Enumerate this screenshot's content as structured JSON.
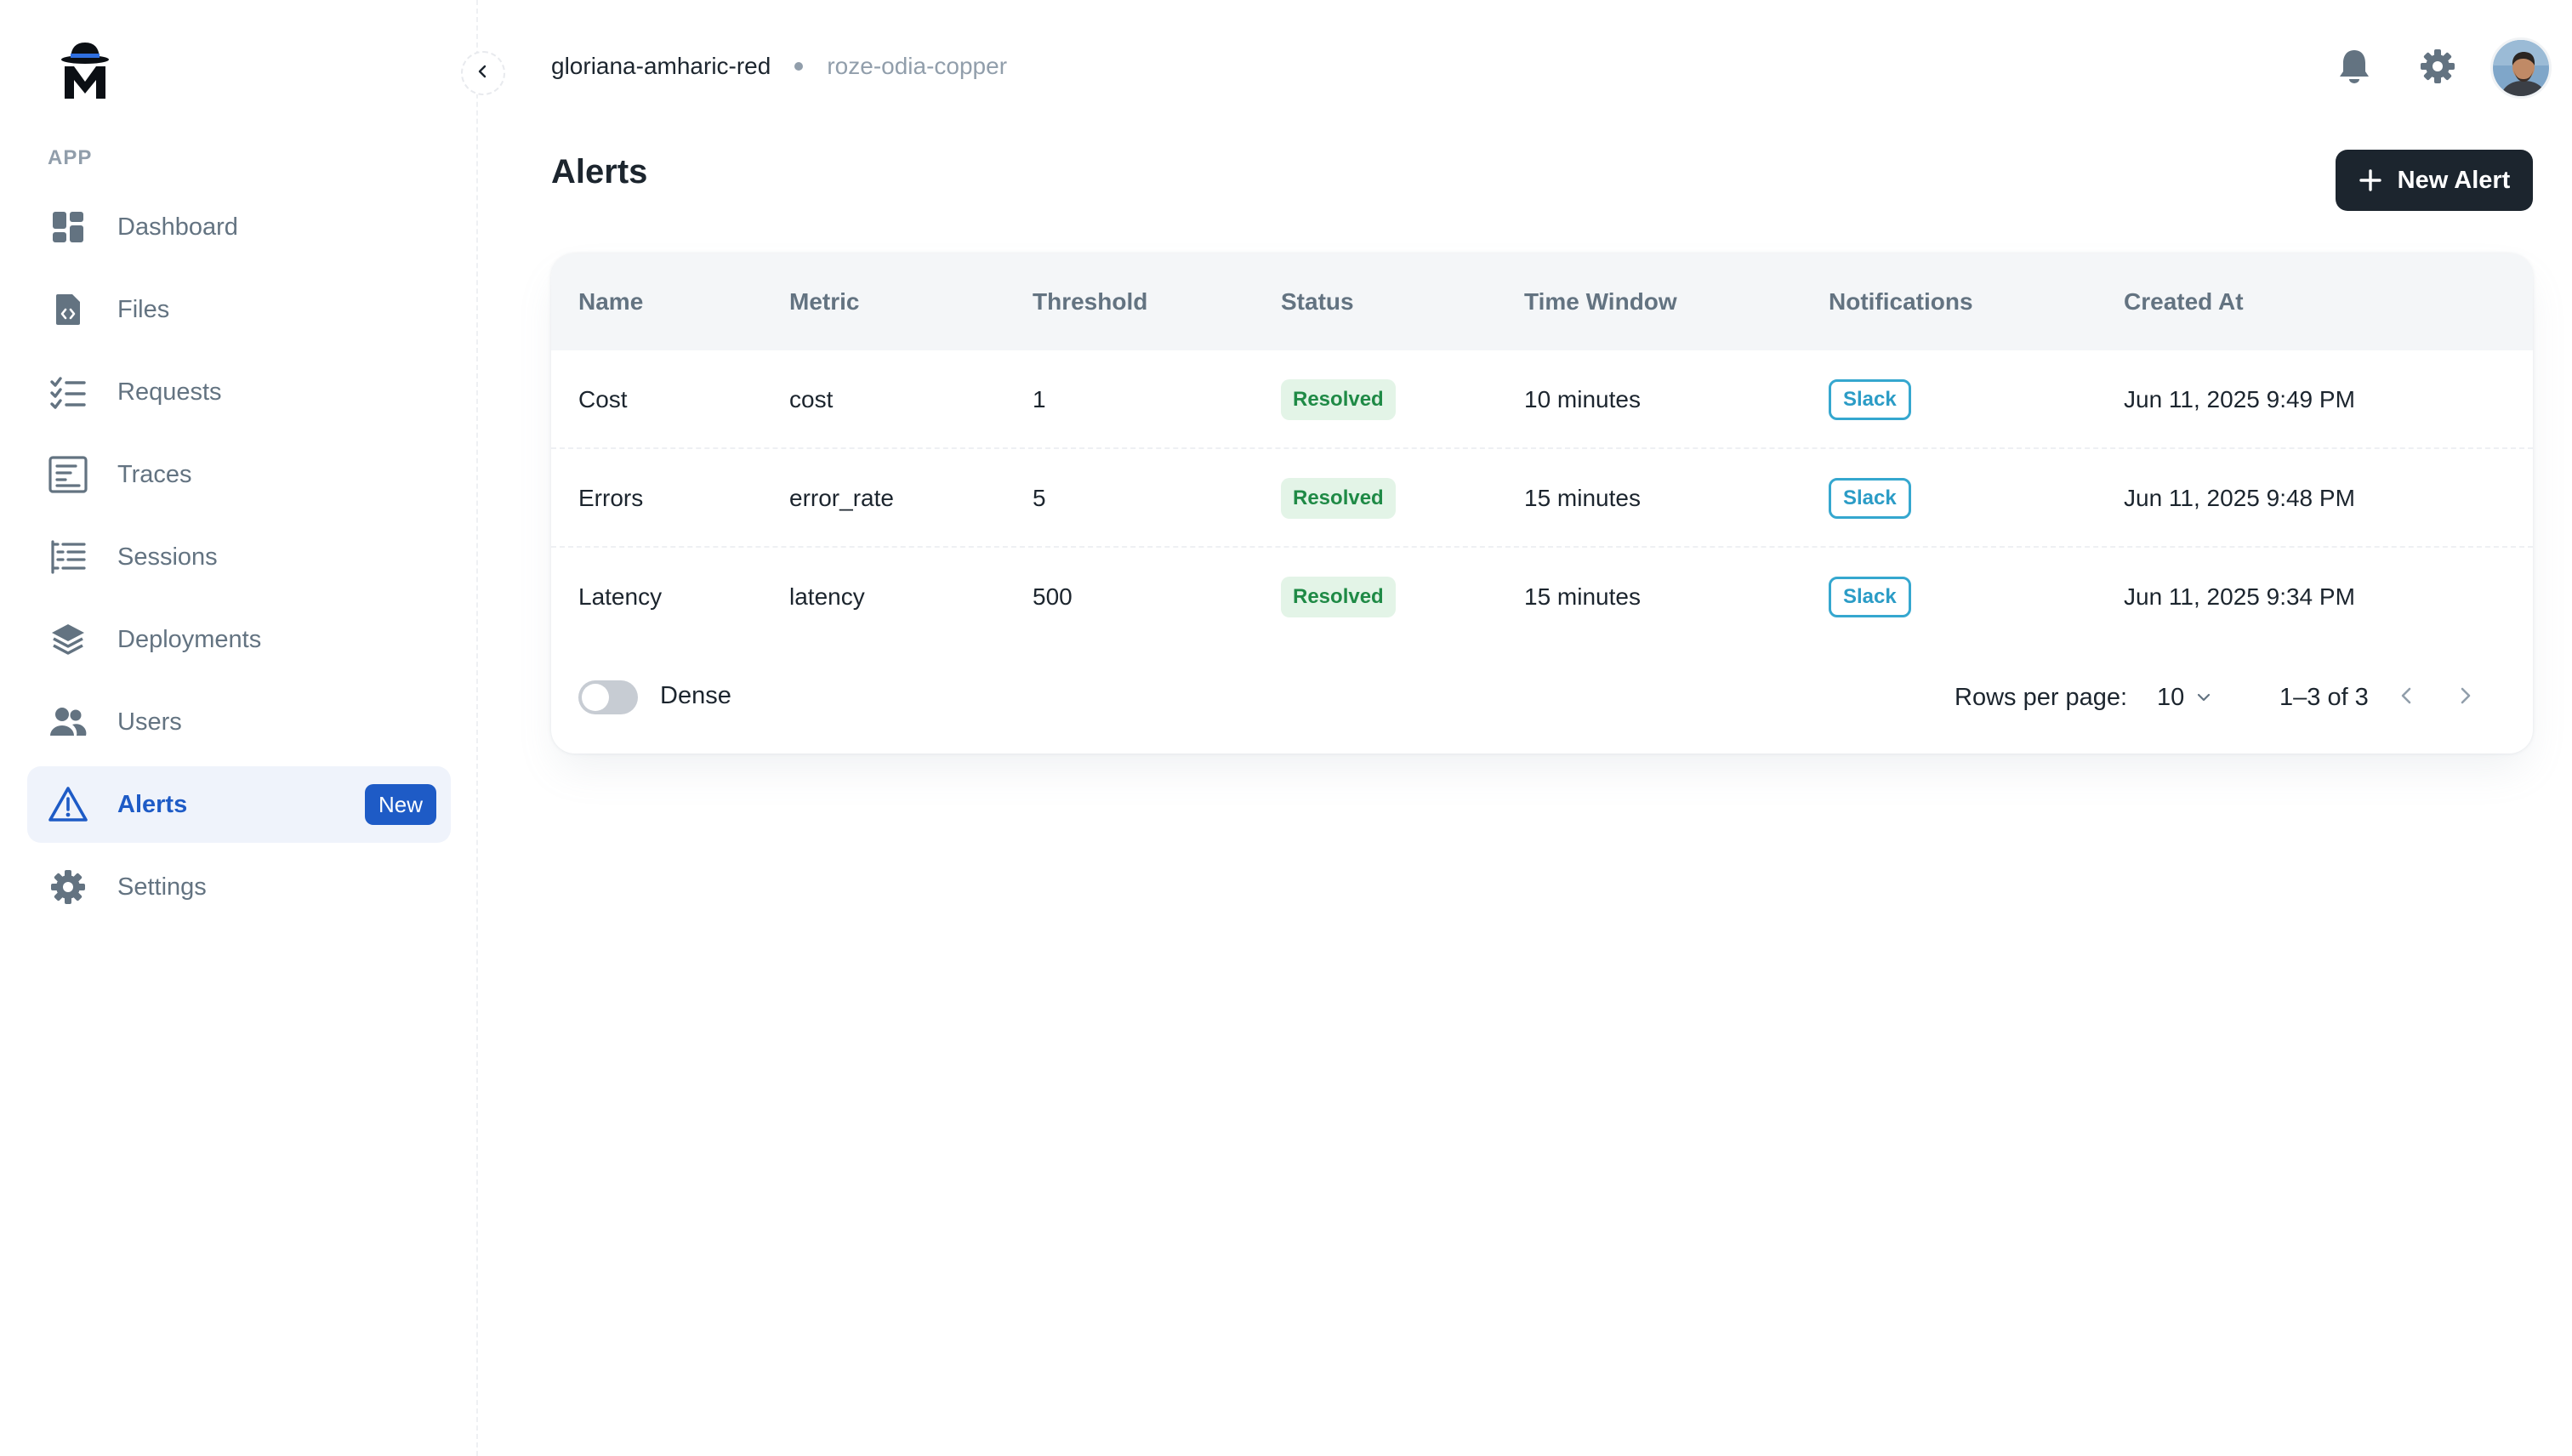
{
  "sidebar": {
    "section_label": "APP",
    "items": [
      {
        "label": "Dashboard",
        "icon": "dashboard-icon"
      },
      {
        "label": "Files",
        "icon": "file-code-icon"
      },
      {
        "label": "Requests",
        "icon": "checklist-icon"
      },
      {
        "label": "Traces",
        "icon": "traces-icon"
      },
      {
        "label": "Sessions",
        "icon": "sessions-list-icon"
      },
      {
        "label": "Deployments",
        "icon": "layers-icon"
      },
      {
        "label": "Users",
        "icon": "users-icon"
      },
      {
        "label": "Alerts",
        "icon": "alert-triangle-icon",
        "badge": "New",
        "active": true
      },
      {
        "label": "Settings",
        "icon": "gear-icon"
      }
    ]
  },
  "header": {
    "org": "gloriana-amharic-red",
    "project": "roze-odia-copper"
  },
  "page": {
    "title": "Alerts",
    "new_button": "New Alert"
  },
  "table": {
    "columns": [
      "Name",
      "Metric",
      "Threshold",
      "Status",
      "Time Window",
      "Notifications",
      "Created At"
    ],
    "rows": [
      {
        "name": "Cost",
        "metric": "cost",
        "threshold": "1",
        "status": "Resolved",
        "window": "10 minutes",
        "notification": "Slack",
        "created": "Jun 11, 2025 9:49 PM"
      },
      {
        "name": "Errors",
        "metric": "error_rate",
        "threshold": "5",
        "status": "Resolved",
        "window": "15 minutes",
        "notification": "Slack",
        "created": "Jun 11, 2025 9:48 PM"
      },
      {
        "name": "Latency",
        "metric": "latency",
        "threshold": "500",
        "status": "Resolved",
        "window": "15 minutes",
        "notification": "Slack",
        "created": "Jun 11, 2025 9:34 PM"
      }
    ]
  },
  "footer": {
    "dense_label": "Dense",
    "dense_on": false,
    "rows_per_page_label": "Rows per page:",
    "rows_per_page_value": "10",
    "range": "1–3 of 3"
  },
  "colors": {
    "accent": "#1e5bc6",
    "dark_button": "#1c252e",
    "resolved_bg": "#e3f4e7",
    "resolved_text": "#1f8a46",
    "slack": "#35a7cf"
  }
}
